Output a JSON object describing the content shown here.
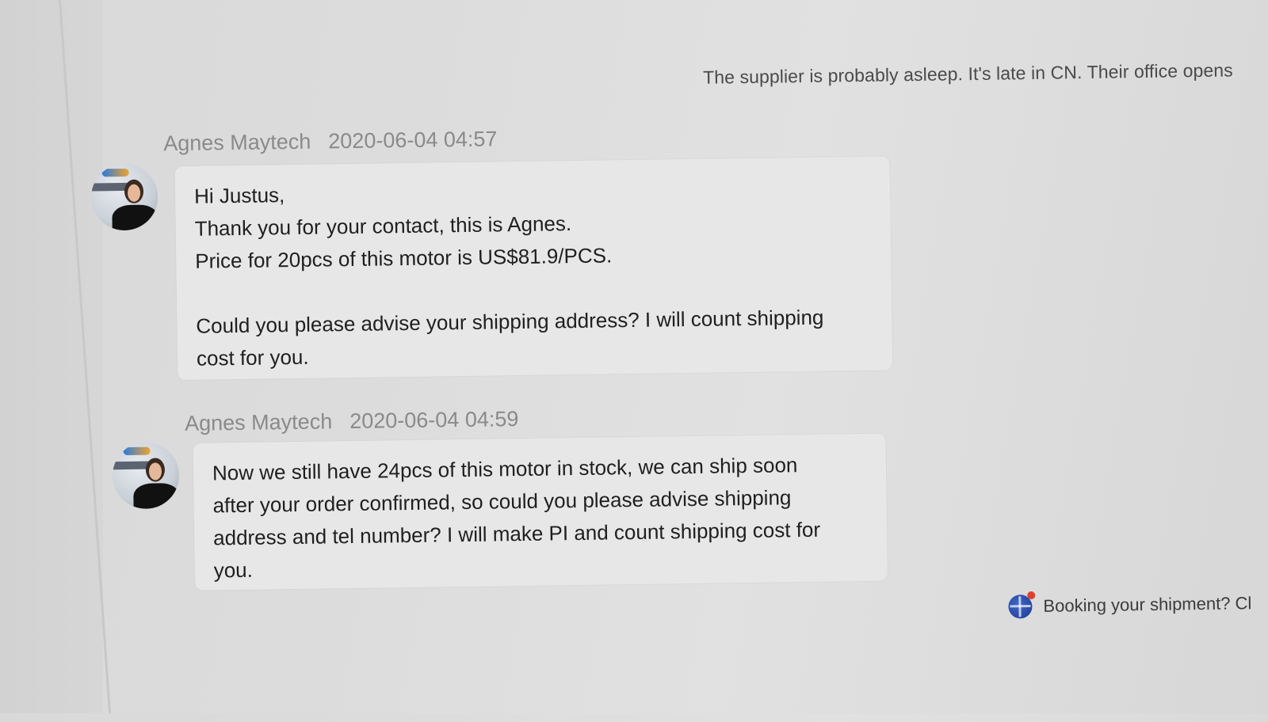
{
  "notice": "The supplier is probably asleep. It's late in CN. Their office opens",
  "messages": [
    {
      "sender": "Agnes Maytech",
      "timestamp": "2020-06-04 04:57",
      "lines": [
        "Hi Justus,",
        "Thank you for your contact, this is Agnes.",
        "Price for 20pcs of this motor is US$81.9/PCS.",
        "",
        "Could you please advise your shipping address? I will count shipping",
        "cost for you."
      ]
    },
    {
      "sender": "Agnes Maytech",
      "timestamp": "2020-06-04 04:59",
      "lines": [
        "Now we still have 24pcs of this motor in stock, we can ship soon",
        "after your order confirmed, so could you please advise shipping",
        "address and tel number? I will make PI and count shipping cost for",
        "you."
      ]
    }
  ],
  "booking": {
    "icon": "globe-icon",
    "text": "Booking your shipment? Cl"
  }
}
